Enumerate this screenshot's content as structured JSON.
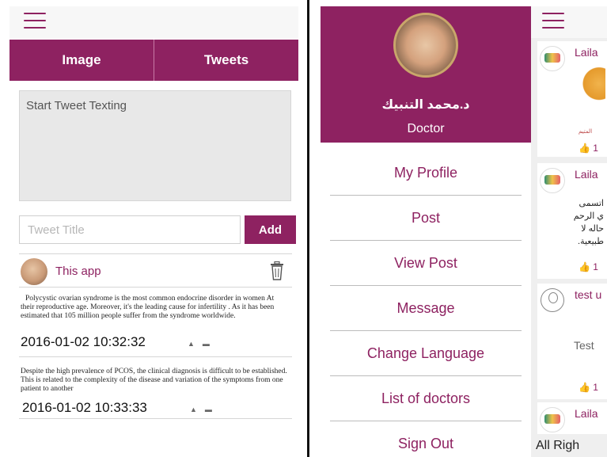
{
  "left_screen": {
    "tabs": [
      {
        "label": "Image"
      },
      {
        "label": "Tweets"
      }
    ],
    "tweet_placeholder": "Start Tweet Texting",
    "title_placeholder": "Tweet Title",
    "add_label": "Add",
    "post": {
      "user": "This app",
      "entries": [
        {
          "text": "Polycystic ovarian syndrome is the most common endocrine disorder in women At their reproductive age. Moreover, it's the leading cause for infertility . As it has been estimated that 105 million people suffer from the syndrome worldwide.",
          "time": "2016-01-02 10:32:32"
        },
        {
          "text": "Despite the high prevalence of PCOS, the clinical diagnosis is difficult to be established. This is related to the complexity of the disease and variation of the symptoms from one patient to another",
          "time": "2016-01-02 10:33:33"
        }
      ]
    }
  },
  "right_screen": {
    "profile": {
      "name": "د.محمد التنبيك",
      "role": "Doctor"
    },
    "menu": [
      {
        "label": "My Profile"
      },
      {
        "label": "Post"
      },
      {
        "label": "View Post"
      },
      {
        "label": "Message"
      },
      {
        "label": "Change Language"
      },
      {
        "label": "List of doctors"
      },
      {
        "label": "Sign Out"
      }
    ],
    "feed": {
      "cards": [
        {
          "user": "Laila",
          "likes": "1",
          "thumb_text": "المتيم"
        },
        {
          "user": "Laila",
          "likes": "1",
          "lines": [
            "اتسمى",
            "ي الرحم",
            "حاله لا",
            "طبيعية."
          ]
        },
        {
          "user": "test u",
          "likes": "1",
          "body": "Test"
        },
        {
          "user": "Laila"
        }
      ],
      "footer": "All Righ"
    },
    "colors": {
      "accent": "#8e2261"
    }
  }
}
